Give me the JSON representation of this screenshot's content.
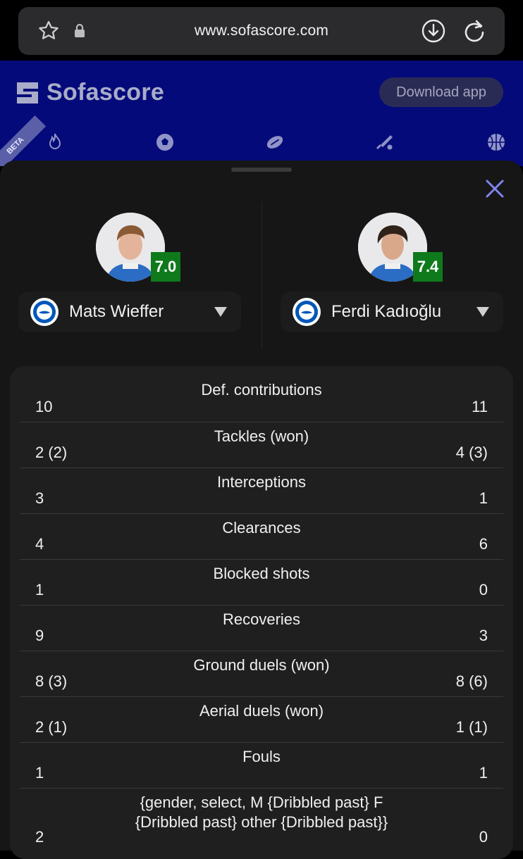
{
  "browser": {
    "url": "www.sofascore.com"
  },
  "site": {
    "logo_text": "Sofascore",
    "download_label": "Download app",
    "beta_label": "BETA",
    "sport_icons": [
      "fire-icon",
      "football-icon",
      "rugby-ball-icon",
      "cricket-icon",
      "basketball-icon"
    ]
  },
  "players": [
    {
      "name": "Mats Wieffer",
      "rating": "7.0"
    },
    {
      "name": "Ferdi Kadıoğlu",
      "rating": "7.4"
    }
  ],
  "stats": [
    {
      "label": "Def. contributions",
      "left": "10",
      "right": "11"
    },
    {
      "label": "Tackles (won)",
      "left": "2 (2)",
      "right": "4 (3)"
    },
    {
      "label": "Interceptions",
      "left": "3",
      "right": "1"
    },
    {
      "label": "Clearances",
      "left": "4",
      "right": "6"
    },
    {
      "label": "Blocked shots",
      "left": "1",
      "right": "0"
    },
    {
      "label": "Recoveries",
      "left": "9",
      "right": "3"
    },
    {
      "label": "Ground duels (won)",
      "left": "8 (3)",
      "right": "8 (6)"
    },
    {
      "label": "Aerial duels (won)",
      "left": "2 (1)",
      "right": "1 (1)"
    },
    {
      "label": "Fouls",
      "left": "1",
      "right": "1"
    },
    {
      "label": "{gender, select, M {Dribbled past} F {Dribbled past} other {Dribbled past}}",
      "left": "2",
      "right": "0"
    }
  ],
  "colors": {
    "header_bg": "#050a7a",
    "sheet_bg": "#161616",
    "card_bg": "#1f1f1f",
    "rating_bg": "#0e7a1c",
    "close_icon": "#7f86f0"
  }
}
